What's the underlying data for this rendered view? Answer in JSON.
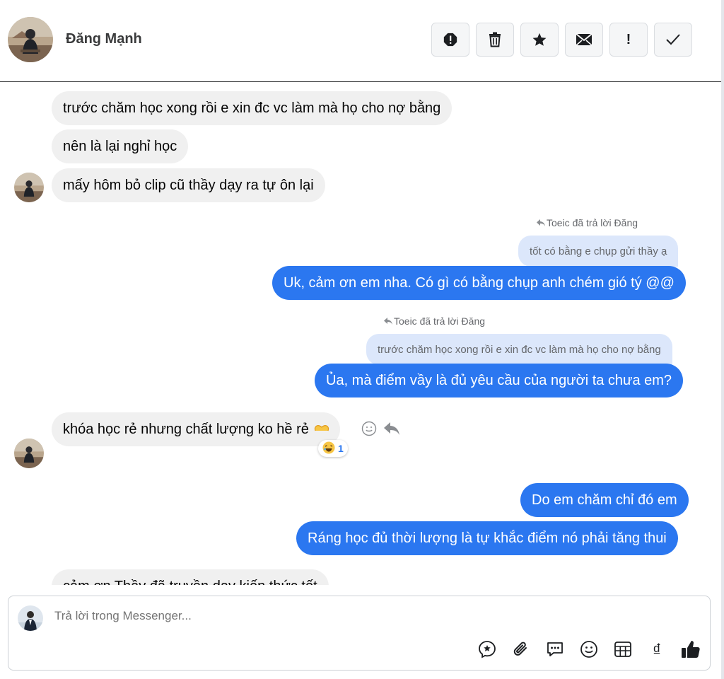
{
  "header": {
    "contact_name": "Đăng Mạnh",
    "actions": [
      {
        "icon": "spam-report-icon"
      },
      {
        "icon": "trash-icon"
      },
      {
        "icon": "star-icon"
      },
      {
        "icon": "envelope-icon"
      },
      {
        "icon": "exclamation-icon",
        "label": "!"
      },
      {
        "icon": "checkmark-icon"
      }
    ]
  },
  "messages": {
    "m1": "trước chăm học xong rồi e xin đc vc làm mà họ cho nợ bằng",
    "m2": "nên là lại nghỉ học",
    "m3": "mấy hôm bỏ clip cũ thầy dạy ra tự ôn lại",
    "reply1_note": "Toeic đã trả lời Đăng",
    "reply1_quote": "tốt có bằng e chụp gửi thầy ạ",
    "m4": "Uk, cảm ơn em nha. Có gì có bằng chụp anh chém gió tý @@",
    "reply2_note": "Toeic đã trả lời Đăng",
    "reply2_quote": "trước chăm học xong rồi e xin đc vc làm mà họ cho nợ bằng",
    "m5": "Ủa, mà điểm vầy là đủ yêu cầu của người ta chưa em?",
    "m6": "khóa học rẻ nhưng chất lượng ko hề rẻ",
    "m6_reaction_count": "1",
    "m7": "Do em chăm chỉ đó em",
    "m8": "Ráng học đủ thời lượng là tự khắc điểm nó phải tăng thui",
    "m9_partial": "cảm ơn Thầy đã truyền dạy kiến thức tốt"
  },
  "composer": {
    "placeholder": "Trả lời trong Messenger...",
    "tools": [
      "saved-reply-icon",
      "attachment-icon",
      "chat-bubble-icon",
      "emoji-icon",
      "table-icon",
      "dong-currency-icon",
      "thumbs-up-icon"
    ],
    "dong_symbol": "₫"
  },
  "colors": {
    "outgoing": "#2b77f0",
    "incoming": "#f0f0f0",
    "quoted": "#dce7fb"
  }
}
